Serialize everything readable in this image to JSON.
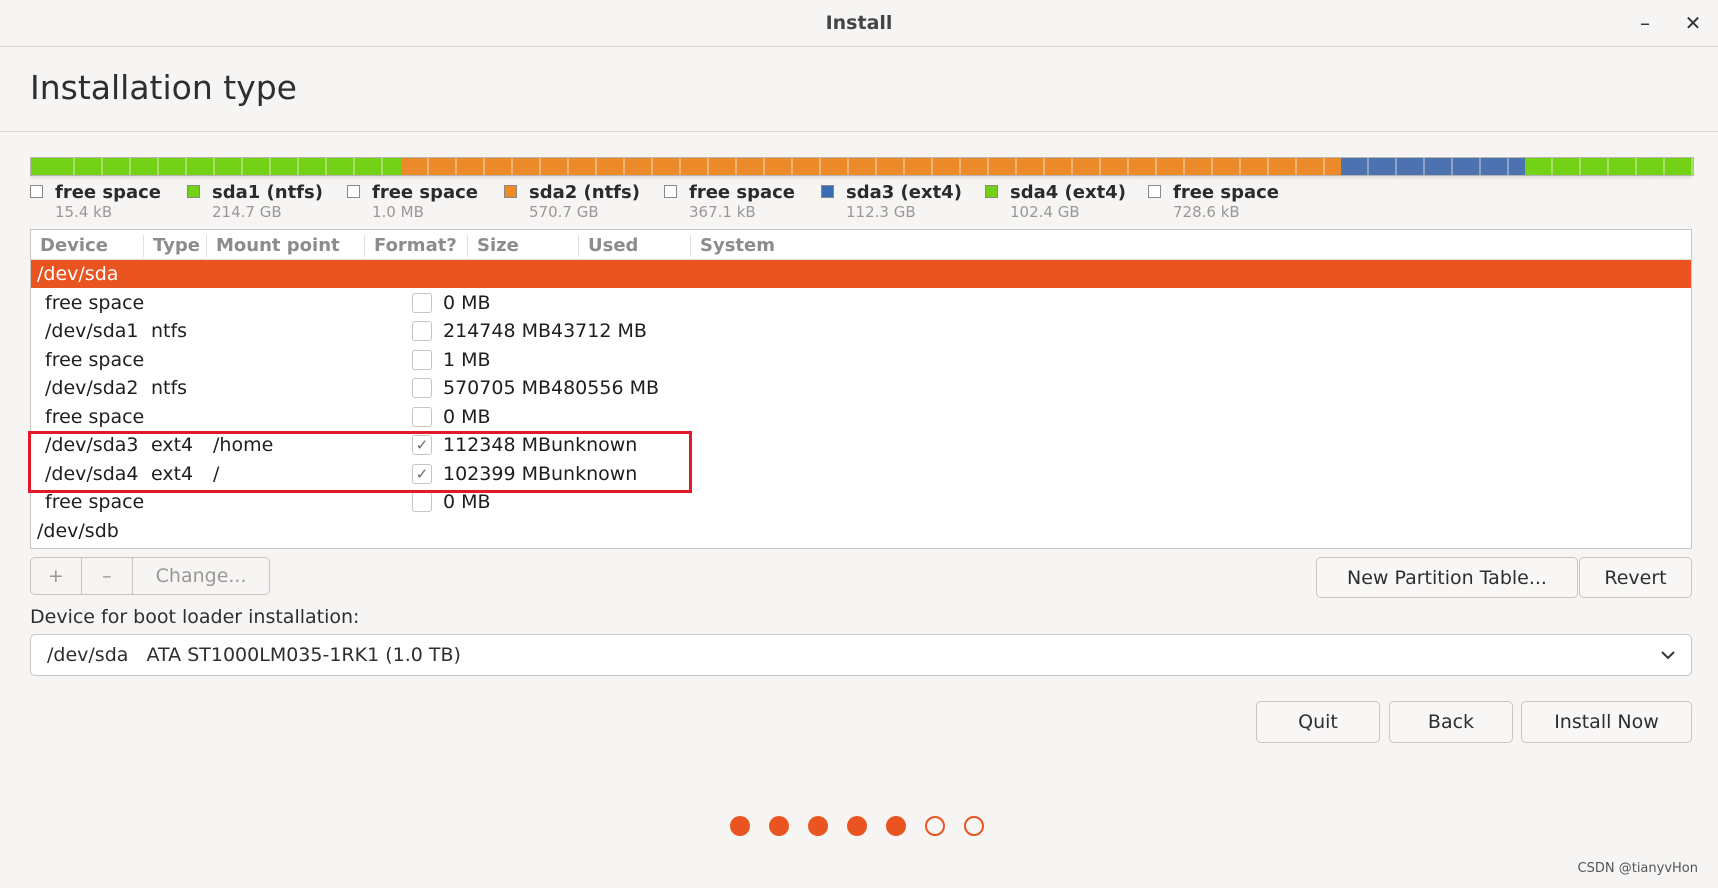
{
  "window": {
    "title": "Install",
    "minimize_icon": "minimize-icon",
    "close_icon": "close-icon",
    "minimize_glyph": "–",
    "close_glyph": "✕"
  },
  "page": {
    "heading": "Installation type"
  },
  "colors": {
    "accent": "#e95420",
    "ntfs": "#f08a24",
    "ext4_home": "#3b6bb2",
    "free_space_bar": "#73d216",
    "highlight": "#e2192a"
  },
  "disk_bar": {
    "segments": [
      {
        "label": "free space",
        "proportion": 0.01,
        "color": "#73d216"
      },
      {
        "label": "sda1 (ntfs)",
        "proportion": 0.214,
        "color": "#73d216"
      },
      {
        "label": "free space",
        "proportion": 0.001,
        "color": "#73d216"
      },
      {
        "label": "sda2 (ntfs)",
        "proportion": 0.57,
        "color": "#ec8a2a"
      },
      {
        "label": "free space",
        "proportion": 0.001,
        "color": "#ec8a2a"
      },
      {
        "label": "sda3 (ext4)",
        "proportion": 0.112,
        "color": "#4d72b0"
      },
      {
        "label": "sda4 (ext4)",
        "proportion": 0.102,
        "color": "#73d216"
      }
    ]
  },
  "legend": [
    {
      "name": "free space",
      "size": "15.4 kB",
      "color": "#ffffff"
    },
    {
      "name": "sda1 (ntfs)",
      "size": "214.7 GB",
      "color": "#73d216"
    },
    {
      "name": "free space",
      "size": "1.0 MB",
      "color": "#ffffff"
    },
    {
      "name": "sda2 (ntfs)",
      "size": "570.7 GB",
      "color": "#f08a24"
    },
    {
      "name": "free space",
      "size": "367.1 kB",
      "color": "#ffffff"
    },
    {
      "name": "sda3 (ext4)",
      "size": "112.3 GB",
      "color": "#3b6bb2"
    },
    {
      "name": "sda4 (ext4)",
      "size": "102.4 GB",
      "color": "#73d216"
    },
    {
      "name": "free space",
      "size": "728.6 kB",
      "color": "#ffffff"
    }
  ],
  "table": {
    "headers": [
      "Device",
      "Type",
      "Mount point",
      "Format?",
      "Size",
      "Used",
      "System"
    ],
    "rows": [
      {
        "device": "/dev/sda",
        "type": "",
        "mount": "",
        "format": null,
        "size": "",
        "used": "",
        "system": "",
        "selected": true,
        "disk": true
      },
      {
        "device": "free space",
        "type": "",
        "mount": "",
        "format": false,
        "size": "0 MB",
        "used": "",
        "system": ""
      },
      {
        "device": "/dev/sda1",
        "type": "ntfs",
        "mount": "",
        "format": false,
        "size": "214748 MB",
        "used": "43712 MB",
        "system": ""
      },
      {
        "device": "free space",
        "type": "",
        "mount": "",
        "format": false,
        "size": "1 MB",
        "used": "",
        "system": ""
      },
      {
        "device": "/dev/sda2",
        "type": "ntfs",
        "mount": "",
        "format": false,
        "size": "570705 MB",
        "used": "480556 MB",
        "system": ""
      },
      {
        "device": "free space",
        "type": "",
        "mount": "",
        "format": false,
        "size": "0 MB",
        "used": "",
        "system": ""
      },
      {
        "device": "/dev/sda3",
        "type": "ext4",
        "mount": "/home",
        "format": true,
        "size": "112348 MB",
        "used": "unknown",
        "system": ""
      },
      {
        "device": "/dev/sda4",
        "type": "ext4",
        "mount": "/",
        "format": true,
        "size": "102399 MB",
        "used": "unknown",
        "system": ""
      },
      {
        "device": "free space",
        "type": "",
        "mount": "",
        "format": false,
        "size": "0 MB",
        "used": "",
        "system": ""
      },
      {
        "device": "/dev/sdb",
        "type": "",
        "mount": "",
        "format": null,
        "size": "",
        "used": "",
        "system": "",
        "disk": true
      }
    ]
  },
  "toolbar": {
    "add_label": "+",
    "remove_label": "–",
    "change_label": "Change..."
  },
  "partition_buttons": {
    "new_table": "New Partition Table...",
    "revert": "Revert"
  },
  "bootloader": {
    "label": "Device for boot loader installation:",
    "value": "/dev/sda   ATA ST1000LM035-1RK1 (1.0 TB)",
    "chevron_icon": "chevron-down-icon"
  },
  "nav_buttons": {
    "quit": "Quit",
    "back": "Back",
    "install": "Install Now"
  },
  "progress": {
    "total_steps": 7,
    "completed_steps": 5
  },
  "watermark": "CSDN @tianyvHon"
}
